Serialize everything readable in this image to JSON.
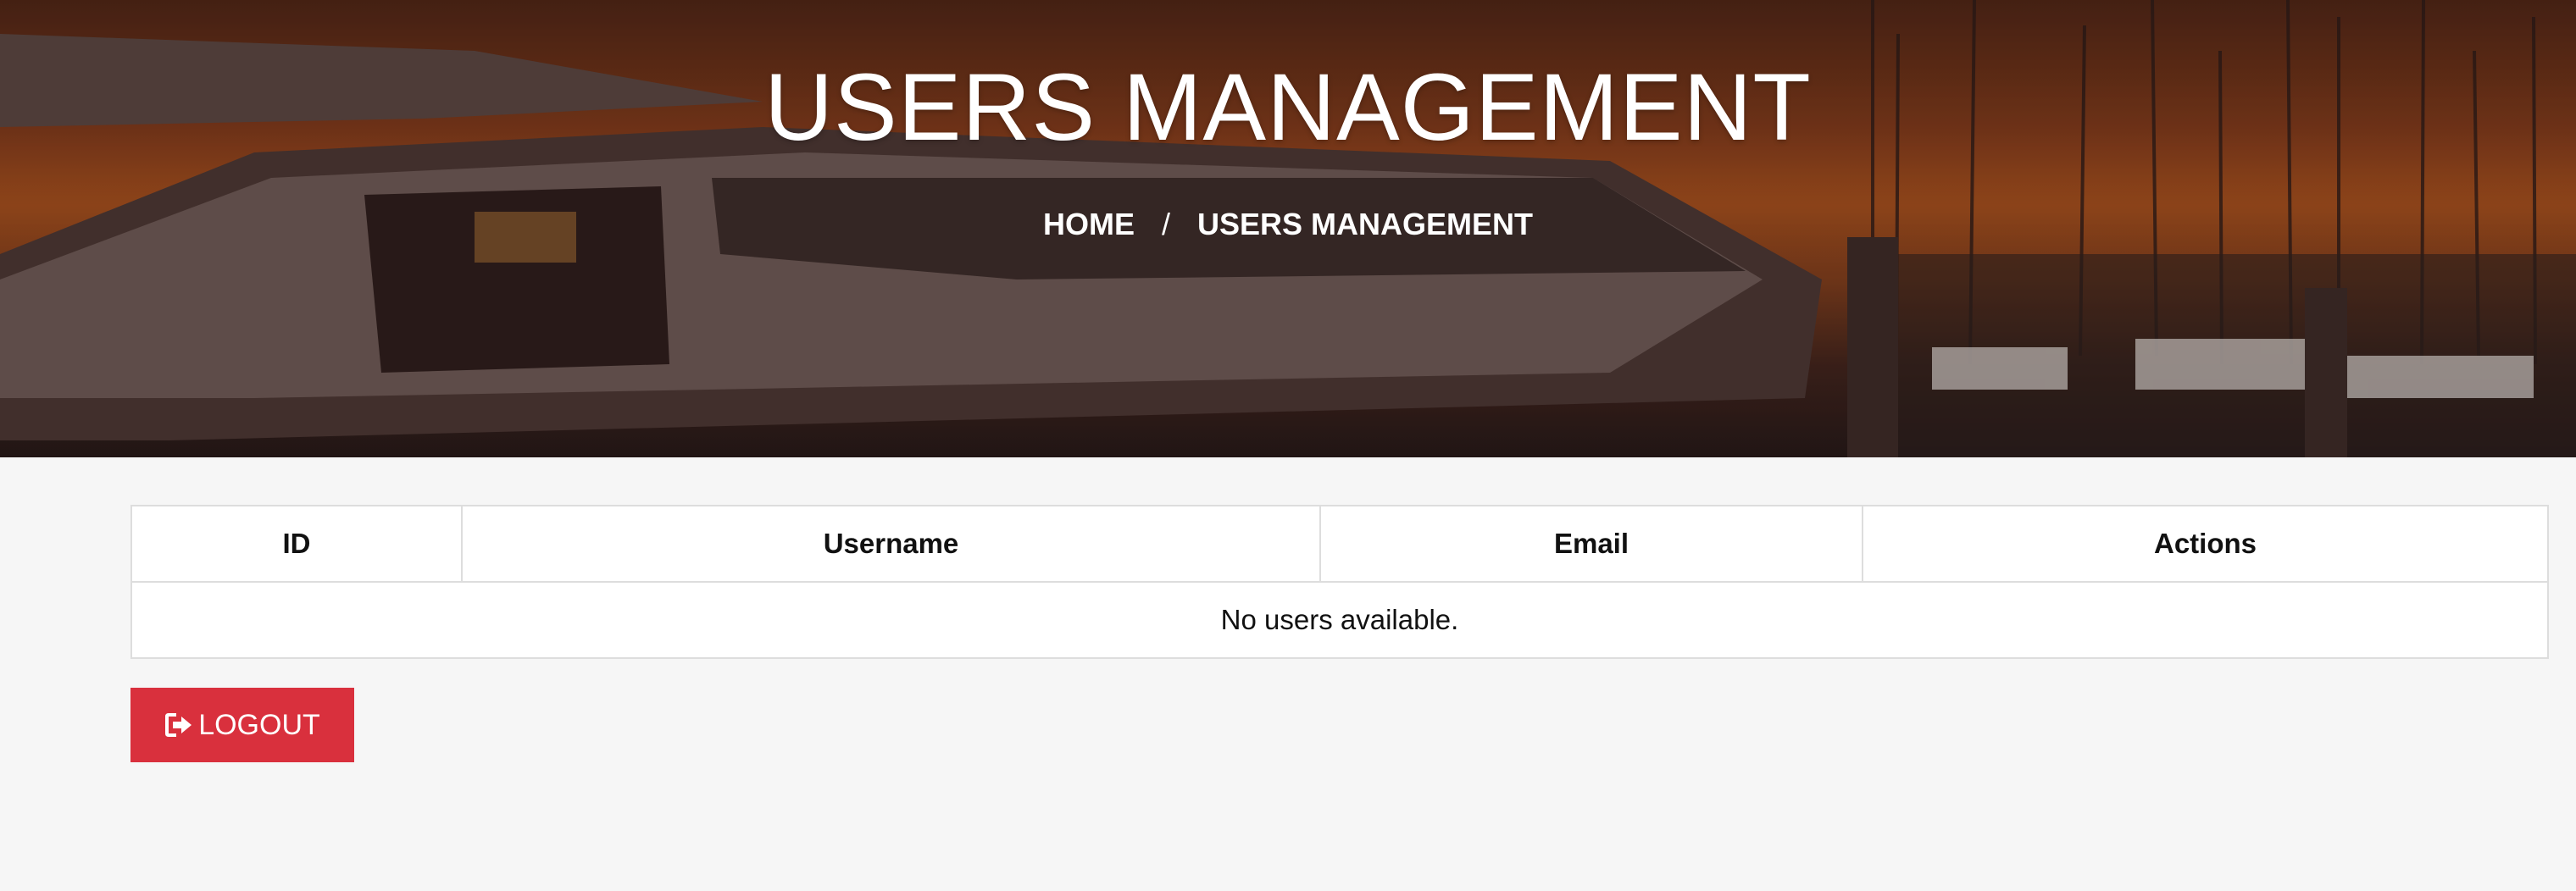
{
  "hero": {
    "title": "USERS MANAGEMENT",
    "breadcrumb": {
      "home_label": "HOME",
      "separator": "/",
      "current_label": "USERS MANAGEMENT"
    }
  },
  "users_table": {
    "columns": [
      "ID",
      "Username",
      "Email",
      "Actions"
    ],
    "empty_message": "No users available."
  },
  "logout_button": {
    "label": "LOGOUT",
    "icon": "sign-out-icon",
    "color": "#d9303d"
  },
  "colors": {
    "page_background": "#f6f6f6",
    "table_border": "#dddddd"
  }
}
